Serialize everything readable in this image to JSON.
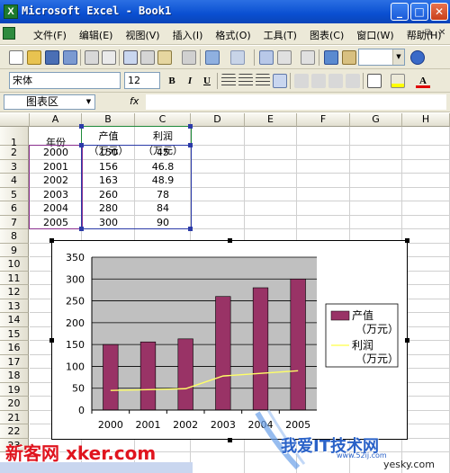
{
  "window": {
    "title": "Microsoft Excel - Book1",
    "app_icon": "X",
    "buttons": {
      "minimize": "_",
      "maximize": "□",
      "close": "✕"
    }
  },
  "menu": {
    "items": [
      "文件(F)",
      "编辑(E)",
      "视图(V)",
      "插入(I)",
      "格式(O)",
      "工具(T)",
      "图表(C)",
      "窗口(W)",
      "帮助(H)"
    ],
    "controls": {
      "minimize": "_",
      "restore": "⧉",
      "close": "✕"
    }
  },
  "format_toolbar": {
    "font": "宋体",
    "size": "12",
    "bold": "B",
    "italic": "I",
    "underline": "U"
  },
  "formula_bar": {
    "name_box": "图表区",
    "fx": "fx",
    "value": ""
  },
  "sheet": {
    "columns": [
      "A",
      "B",
      "C",
      "D",
      "E",
      "F",
      "G",
      "H"
    ],
    "rows": [
      "1",
      "2",
      "3",
      "4",
      "5",
      "6",
      "7",
      "8",
      "9",
      "10",
      "11",
      "12",
      "13",
      "14",
      "15",
      "16",
      "17",
      "18",
      "19",
      "20",
      "21",
      "22",
      "23"
    ],
    "header": {
      "a1": "年份",
      "b1_line1": "产值",
      "b1_line2": "（万元）",
      "c1_line1": "利润",
      "c1_line2": "（万元）"
    },
    "data": [
      [
        "2000",
        "150",
        "45"
      ],
      [
        "2001",
        "156",
        "46.8"
      ],
      [
        "2002",
        "163",
        "48.9"
      ],
      [
        "2003",
        "260",
        "78"
      ],
      [
        "2004",
        "280",
        "84"
      ],
      [
        "2005",
        "300",
        "90"
      ]
    ]
  },
  "chart_data": {
    "type": "bar",
    "categories": [
      "2000",
      "2001",
      "2002",
      "2003",
      "2004",
      "2005"
    ],
    "series": [
      {
        "name": "产值（万元）",
        "type": "bar",
        "values": [
          150,
          156,
          163,
          260,
          280,
          300
        ],
        "color": "#993366"
      },
      {
        "name": "利润（万元）",
        "type": "line",
        "values": [
          45,
          46.8,
          48.9,
          78,
          84,
          90
        ],
        "color": "#ffff66"
      }
    ],
    "yticks": [
      "0",
      "50",
      "100",
      "150",
      "200",
      "250",
      "300",
      "350"
    ],
    "ylim": [
      0,
      350
    ],
    "plot_background": "#c0c0c0",
    "legend": {
      "position": "right",
      "bar_line1": "产值",
      "bar_line2": "（万元）",
      "line_line1": "利润",
      "line_line2": "（万元）"
    }
  },
  "watermarks": {
    "left": "新客网 xker.com",
    "right": "我爱IT技术网",
    "right_url": "www.52ij.com",
    "right_small": "yesky.com"
  },
  "colors": {
    "titlebar": "#0a4fd1",
    "toolbar": "#ece9d8",
    "selection": "#2b3aa8"
  }
}
